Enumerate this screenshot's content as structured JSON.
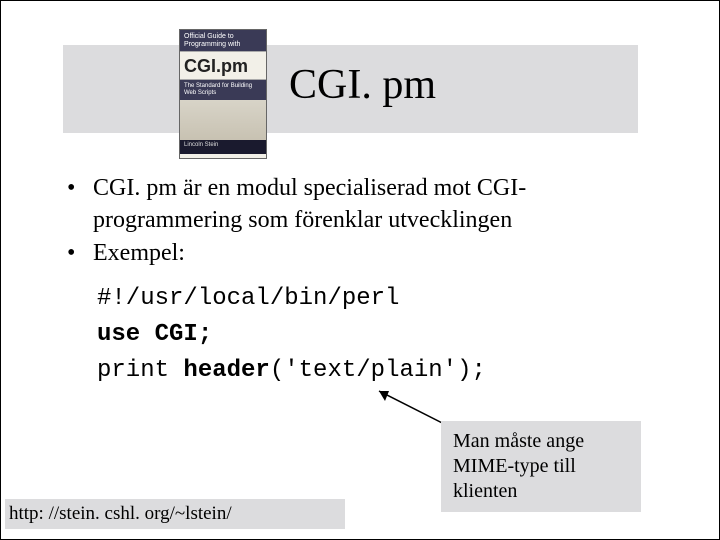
{
  "book": {
    "banner": "Official Guide to Programming with",
    "title": "CGI.pm",
    "sub": "The Standard for Building Web Scripts",
    "author": "Lincoln Stein"
  },
  "title": "CGI. pm",
  "bullets": {
    "b1": "CGI. pm är en modul specialiserad mot CGI-programmering som förenklar utvecklingen",
    "b2": "Exempel:"
  },
  "code": {
    "l1": "#!/usr/local/bin/perl",
    "l2a": "use CGI;",
    "l3a": "print ",
    "l3b": "header",
    "l3c": "('text/plain');"
  },
  "callout": "Man måste ange MIME-type till klienten",
  "footer": "http: //stein. cshl. org/~lstein/"
}
